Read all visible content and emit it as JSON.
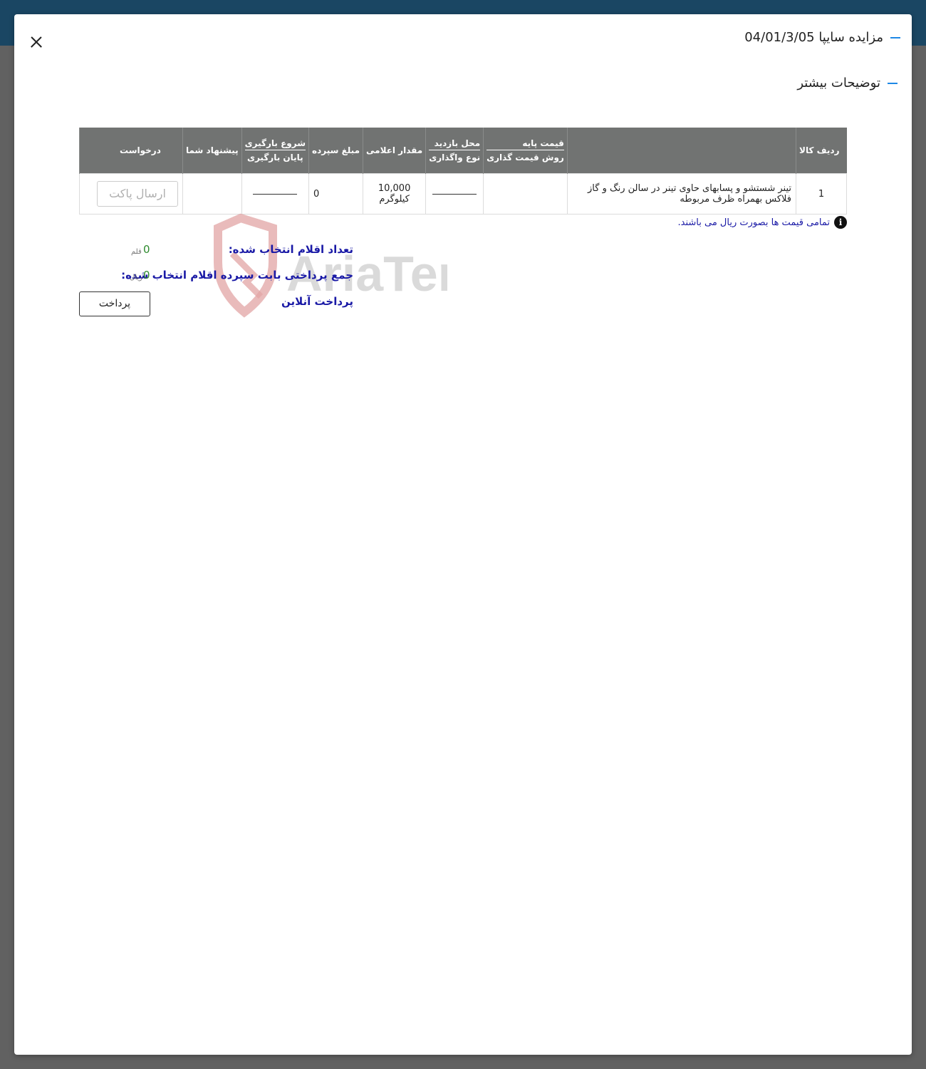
{
  "header": {
    "title": "مزایده سایپا 04/01/3/05",
    "section_title": "توضیحات بیشتر"
  },
  "table": {
    "columns": {
      "row_item": "ردیف کالا",
      "base_price": "قیمت پایه",
      "pricing_method": "روش قیمت گذاری",
      "visit_place": "محل بازدید",
      "assign_type": "نوع واگذاری",
      "announced_qty": "مقدار اعلامی",
      "deposit_amount": "مبلغ سپرده",
      "loading_start": "شروع بارگیری",
      "loading_end": "پایان بارگیری",
      "your_offer": "پیشنهاد شما",
      "request": "درخواست"
    },
    "rows": [
      {
        "index": "1",
        "item": "تینر شستشو و پسابهای حاوی تینر در سالن رنگ و گاز فلاکس بهمراه ظرف مربوطه",
        "quantity": "10,000",
        "unit": "کیلوگرم",
        "deposit": "0",
        "request_button": "ارسال پاکت"
      }
    ]
  },
  "note": "تمامی قیمت ها بصورت ریال می باشند.",
  "summary": {
    "selected_label": "تعداد اقلام انتخاب شده:",
    "selected_value": "0",
    "selected_unit": "قلم",
    "payment_label": "جمع پرداختی بابت سپرده اقلام انتخاب شده:",
    "payment_value": "0",
    "payment_unit": "ریال",
    "online_payment": "پرداخت آنلاین",
    "pay_button": "پرداخت"
  },
  "watermark": {
    "text": "AriaTender.neT"
  },
  "colors": {
    "topbar": "#1a4663",
    "table_header": "#717372",
    "accent_dash": "#1e88e5",
    "summary_label": "#1a1aa6",
    "summary_value": "#2e8b2e",
    "watermark_red": "#e09a9a"
  }
}
